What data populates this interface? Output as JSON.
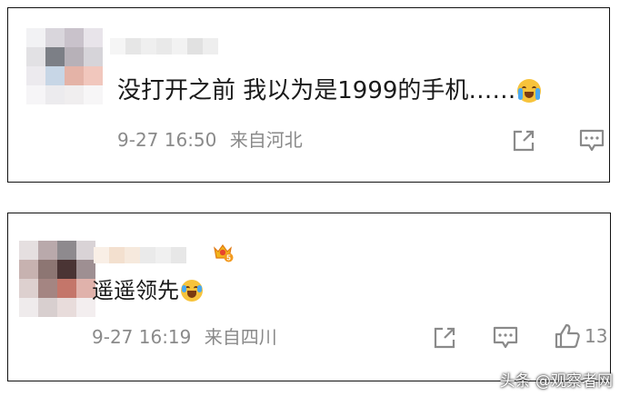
{
  "comments": [
    {
      "username": "",
      "text": "没打开之前 我以为是1999的手机……",
      "emoji": "crying-face-emoji",
      "time": "9-27 16:50",
      "location": "来自河北",
      "actions": [
        "share-icon",
        "reply-icon"
      ],
      "avatar_colors": [
        "#f2f2f4",
        "#d9d6dc",
        "#c9c2cb",
        "#e8e4ea",
        "#e2e1e4",
        "#7c7f86",
        "#b7b1b8",
        "#d6d4d9",
        "#eceaee",
        "#c7d6e6",
        "#e4b3a7",
        "#f1c7bd",
        "#f6f5f7",
        "#ecebee",
        "#f0eeef",
        "#f7f6f7"
      ],
      "name_colors": [
        "#f5f5f5",
        "#e6e6e6",
        "#efefef",
        "#e9e9e9",
        "#f2f2f2",
        "#e1e1e1",
        "#eeeeee"
      ]
    },
    {
      "username": "",
      "text": "遥遥领先",
      "emoji": "laughing-tears-emoji",
      "time": "9-27 16:19",
      "location": "来自四川",
      "like_count": "13",
      "actions": [
        "share-icon",
        "reply-icon",
        "like-icon"
      ],
      "avatar_colors": [
        "#e5dfe0",
        "#b9a9ab",
        "#8e8a8e",
        "#d9d3d6",
        "#c7b2b0",
        "#8d7673",
        "#4a3434",
        "#9e8f92",
        "#ddd0cf",
        "#a48582",
        "#c4766a",
        "#e0b2ab",
        "#efebec",
        "#d8cfcf",
        "#e8dcdb",
        "#f3eeef"
      ],
      "name_colors": [
        "#f9efe6",
        "#f3e0cf",
        "#f6e9dd",
        "#eaeaea",
        "#f0f0f0",
        "#e7e7e7"
      ],
      "badge": "crown-level-badge",
      "badge_level": "5"
    }
  ],
  "watermark": "头条 @观察者网"
}
